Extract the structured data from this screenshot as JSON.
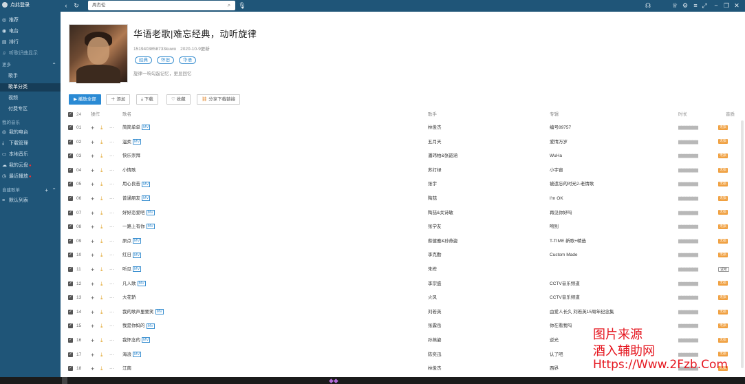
{
  "sidebar": {
    "login": "点此登录",
    "nav": [
      "推荐",
      "电台",
      "排行"
    ],
    "section_label": "听歌识曲显示",
    "library_group": "更多",
    "library_items": [
      "歌手",
      "歌单分类",
      "视频",
      "付费专区"
    ],
    "my_music_group": "我的音乐",
    "my_items": [
      "我的电台",
      "下载管理",
      "本地音乐",
      "我的云盘",
      "最近播放"
    ],
    "created_group": "自建歌单",
    "playlists": [
      "默认列表"
    ]
  },
  "topbar": {
    "search_value": "周杰伦"
  },
  "playlist": {
    "title": "华语老歌|难忘经典，动听旋律",
    "id_text": "1519403858733kuwo",
    "date_text": "2020-10-9更新",
    "tags": [
      "经典",
      "怀旧",
      "华语"
    ],
    "description": "旋律一响勾起记忆，更显回忆"
  },
  "actions": {
    "play_all": "▶ 播放全部",
    "add": "添加",
    "download": "下载",
    "collect": "收藏",
    "share": "分享下载链接"
  },
  "table": {
    "count": "24",
    "headers": {
      "op": "操作",
      "song": "歌名",
      "singer": "歌手",
      "album": "专辑",
      "duration": "时长",
      "quality": "音质"
    },
    "rows": [
      {
        "num": "01",
        "song": "简简单单",
        "mv": "MV",
        "singer": "林俊杰",
        "album": "编号89757",
        "quality": "无损"
      },
      {
        "num": "02",
        "song": "温柔",
        "mv": "MV",
        "singer": "五月天",
        "album": "爱情万岁",
        "quality": "无损"
      },
      {
        "num": "03",
        "song": "快乐崇拜",
        "mv": "",
        "singer": "潘玮柏&张韶涵",
        "album": "WuHa",
        "quality": "无损"
      },
      {
        "num": "04",
        "song": "小情歌",
        "mv": "",
        "singer": "苏打绿",
        "album": "小宇宙",
        "quality": "无损"
      },
      {
        "num": "05",
        "song": "用心良苦",
        "mv": "MV",
        "singer": "张宇",
        "album": "被遗忘的时光2-老情歌",
        "quality": "无损"
      },
      {
        "num": "06",
        "song": "普通朋友",
        "mv": "MV",
        "singer": "陶喆",
        "album": "I'm OK",
        "quality": "无损"
      },
      {
        "num": "07",
        "song": "好好恋爱吧",
        "mv": "MV",
        "singer": "陶喆&关诗敏",
        "album": "再见你好吗",
        "quality": "无损"
      },
      {
        "num": "08",
        "song": "一路上有你",
        "mv": "MV",
        "singer": "张学友",
        "album": "吻别",
        "quality": "无损"
      },
      {
        "num": "09",
        "song": "原点",
        "mv": "MV",
        "singer": "蔡健雅&孙燕姿",
        "album": "T-TIME 新歌+精选",
        "quality": "无损"
      },
      {
        "num": "10",
        "song": "红日",
        "mv": "MV",
        "singer": "李克勤",
        "album": "Custom Made",
        "quality": "无损"
      },
      {
        "num": "11",
        "song": "听见",
        "mv": "MV",
        "singer": "朱桦",
        "album": "",
        "quality": "试听"
      },
      {
        "num": "12",
        "song": "凡人歌",
        "mv": "MV",
        "singer": "李宗盛",
        "album": "CCTV音乐频道",
        "quality": "无损"
      },
      {
        "num": "13",
        "song": "大花轿",
        "mv": "",
        "singer": "火风",
        "album": "CCTV音乐频道",
        "quality": "无损"
      },
      {
        "num": "14",
        "song": "我的歌声里要笑",
        "mv": "MV",
        "singer": "刘若英",
        "album": "由爱人长久 刘若英15周年纪念集",
        "quality": "无损"
      },
      {
        "num": "15",
        "song": "我是你妈的",
        "mv": "MV",
        "singer": "张震岳",
        "album": "你在看我吗",
        "quality": "无损"
      },
      {
        "num": "16",
        "song": "我怀念的",
        "mv": "MV",
        "singer": "孙燕姿",
        "album": "逆光",
        "quality": "无损"
      },
      {
        "num": "17",
        "song": "海浪",
        "mv": "MV",
        "singer": "陈奕迅",
        "album": "认了吧",
        "quality": "无损"
      },
      {
        "num": "18",
        "song": "江南",
        "mv": "",
        "singer": "林俊杰",
        "album": "西界",
        "quality": "无损"
      }
    ]
  },
  "watermark": {
    "line1": "图片来源",
    "line2": "酒入辅助网",
    "line3": "Https://Www.2Fzb.Com"
  },
  "colors": {
    "sidebar": "#1f5578",
    "accent": "#2a8ad4",
    "quality_badge": "#f0a040"
  }
}
